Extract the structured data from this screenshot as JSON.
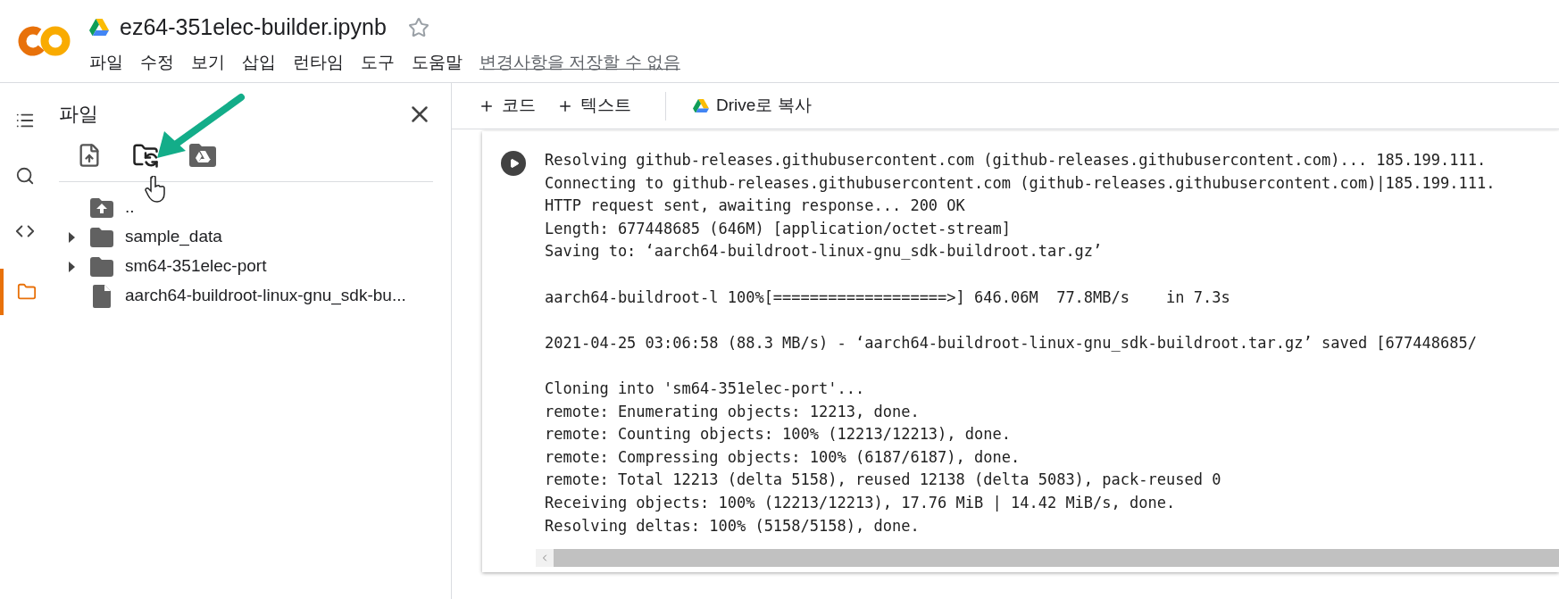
{
  "header": {
    "title": "ez64-351elec-builder.ipynb",
    "starred": false,
    "menu": [
      "파일",
      "수정",
      "보기",
      "삽입",
      "런타임",
      "도구",
      "도움말"
    ],
    "save_notice": "변경사항을 저장할 수 없음"
  },
  "rail": [
    {
      "kind": "toc",
      "selected": false
    },
    {
      "kind": "search",
      "selected": false
    },
    {
      "kind": "code",
      "selected": false
    },
    {
      "kind": "files",
      "selected": true
    }
  ],
  "sidebar": {
    "title": "파일",
    "tools": [
      {
        "kind": "upload"
      },
      {
        "kind": "refresh"
      },
      {
        "kind": "drive"
      }
    ],
    "tree": [
      {
        "kind": "parent",
        "name": "..",
        "expandable": false
      },
      {
        "kind": "folder",
        "name": "sample_data",
        "expandable": true
      },
      {
        "kind": "folder",
        "name": "sm64-351elec-port",
        "expandable": true
      },
      {
        "kind": "file",
        "name": "aarch64-buildroot-linux-gnu_sdk-bu...",
        "expandable": false
      }
    ]
  },
  "toolbar": {
    "buttons": [
      {
        "kind": "add",
        "label": "코드"
      },
      {
        "kind": "add",
        "label": "텍스트"
      },
      {
        "kind": "drive",
        "label": "Drive로 복사"
      }
    ]
  },
  "output": [
    [
      "Resolving github-releases.githubusercontent.com (github-releases.githubusercontent.com)... 185.199.111.",
      "Connecting to github-releases.githubusercontent.com (github-releases.githubusercontent.com)|185.199.111.",
      "HTTP request sent, awaiting response... 200 OK",
      "Length: 677448685 (646M) [application/octet-stream]",
      "Saving to: ‘aarch64-buildroot-linux-gnu_sdk-buildroot.tar.gz’"
    ],
    [
      "aarch64-buildroot-l 100%[===================>] 646.06M  77.8MB/s    in 7.3s"
    ],
    [
      "2021-04-25 03:06:58 (88.3 MB/s) - ‘aarch64-buildroot-linux-gnu_sdk-buildroot.tar.gz’ saved [677448685/"
    ],
    [
      "Cloning into 'sm64-351elec-port'...",
      "remote: Enumerating objects: 12213, done.",
      "remote: Counting objects: 100% (12213/12213), done.",
      "remote: Compressing objects: 100% (6187/6187), done.",
      "remote: Total 12213 (delta 5158), reused 12138 (delta 5083), pack-reused 0",
      "Receiving objects: 100% (12213/12213), 17.76 MiB | 14.42 MiB/s, done.",
      "Resolving deltas: 100% (5158/5158), done."
    ]
  ]
}
